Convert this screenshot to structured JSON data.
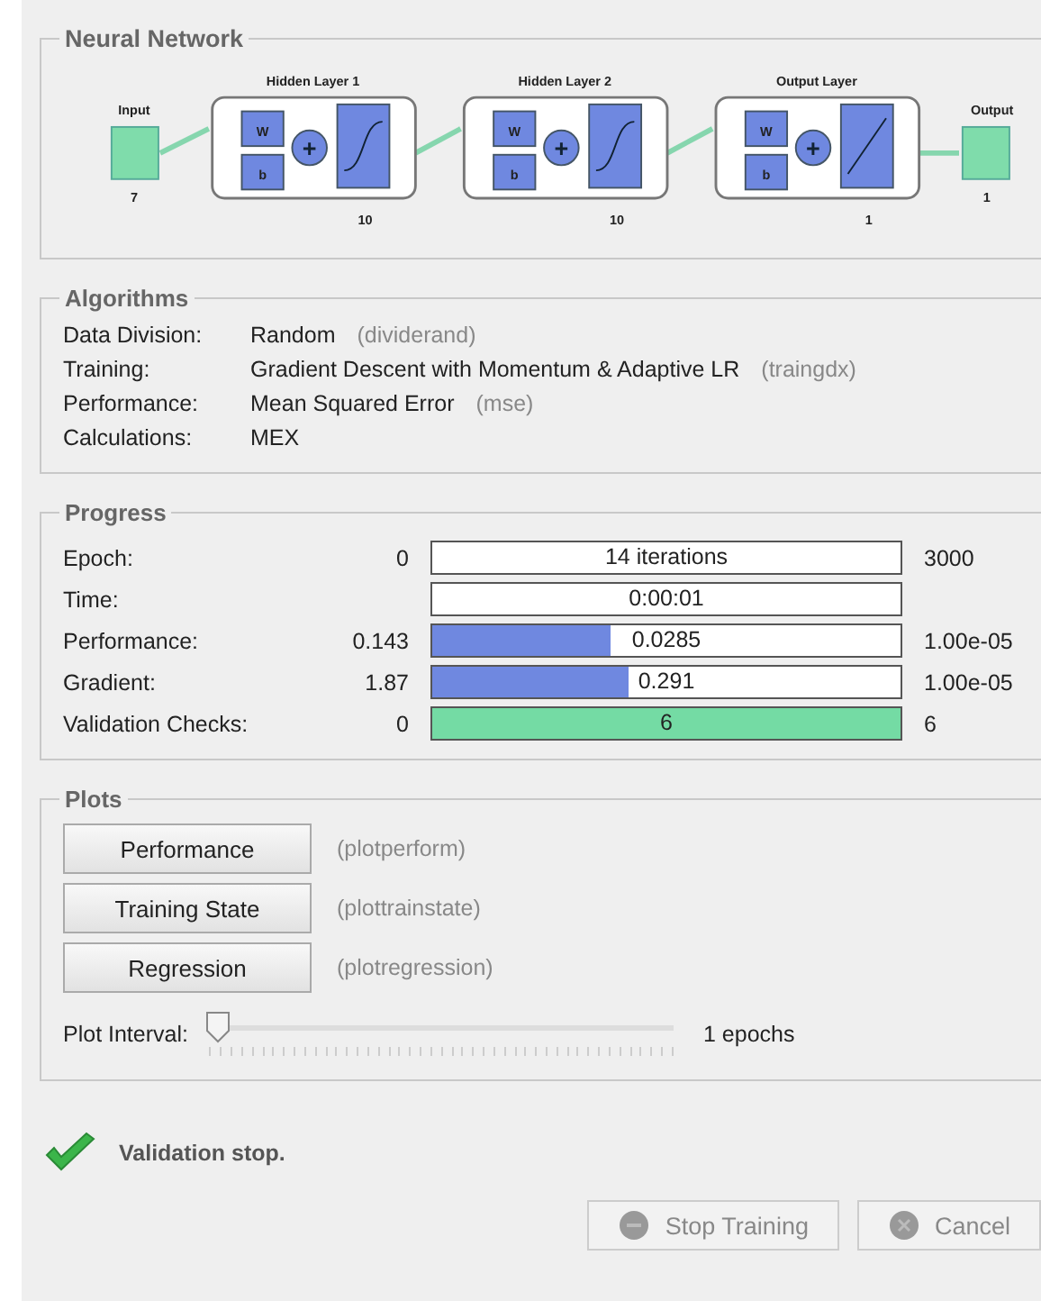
{
  "network": {
    "title": "Neural Network",
    "input": {
      "label": "Input",
      "size": "7"
    },
    "layers": [
      {
        "title": "Hidden Layer 1",
        "weight": "W",
        "bias": "b",
        "sum": "+",
        "size": "10",
        "kind": "sigmoid"
      },
      {
        "title": "Hidden Layer 2",
        "weight": "W",
        "bias": "b",
        "sum": "+",
        "size": "10",
        "kind": "sigmoid"
      },
      {
        "title": "Output Layer",
        "weight": "W",
        "bias": "b",
        "sum": "+",
        "size": "1",
        "kind": "linear"
      }
    ],
    "output": {
      "label": "Output",
      "size": "1"
    }
  },
  "algorithms": {
    "title": "Algorithms",
    "rows": [
      {
        "label": "Data Division:",
        "value": "Random",
        "func": "(dividerand)"
      },
      {
        "label": "Training:",
        "value": "Gradient Descent with Momentum & Adaptive LR",
        "func": "(traingdx)"
      },
      {
        "label": "Performance:",
        "value": "Mean Squared Error",
        "func": "(mse)"
      },
      {
        "label": "Calculations:",
        "value": "MEX"
      }
    ]
  },
  "progress": {
    "title": "Progress",
    "rows": [
      {
        "kind": "readout",
        "label": "Epoch:",
        "start": "0",
        "text": "14 iterations",
        "end": "3000"
      },
      {
        "kind": "readout",
        "label": "Time:",
        "text": "0:00:01"
      },
      {
        "kind": "meter",
        "label": "Performance:",
        "start": "0.143",
        "text": "0.0285",
        "end": "1.00e-05",
        "level": 0.38,
        "color": "#6f88e0"
      },
      {
        "kind": "meter",
        "label": "Gradient:",
        "start": "1.87",
        "text": "0.291",
        "end": "1.00e-05",
        "level": 0.42,
        "color": "#6f88e0"
      },
      {
        "kind": "meter",
        "label": "Validation Checks:",
        "start": "0",
        "text": "6",
        "end": "6",
        "level": 1,
        "color": "#74dba4"
      }
    ]
  },
  "plots": {
    "title": "Plots",
    "buttons": [
      {
        "label": "Performance",
        "func": "(plotperform)"
      },
      {
        "label": "Training State",
        "func": "(plottrainstate)"
      },
      {
        "label": "Regression",
        "func": "(plotregression)"
      }
    ],
    "interval": {
      "label": "Plot Interval:",
      "level": 0,
      "value": "1 epochs"
    }
  },
  "status": {
    "text": "Validation stop."
  },
  "actions": [
    {
      "label": "Stop Training",
      "kind": "stop",
      "disabled": true
    },
    {
      "label": "Cancel",
      "kind": "cancel",
      "disabled": true
    }
  ]
}
